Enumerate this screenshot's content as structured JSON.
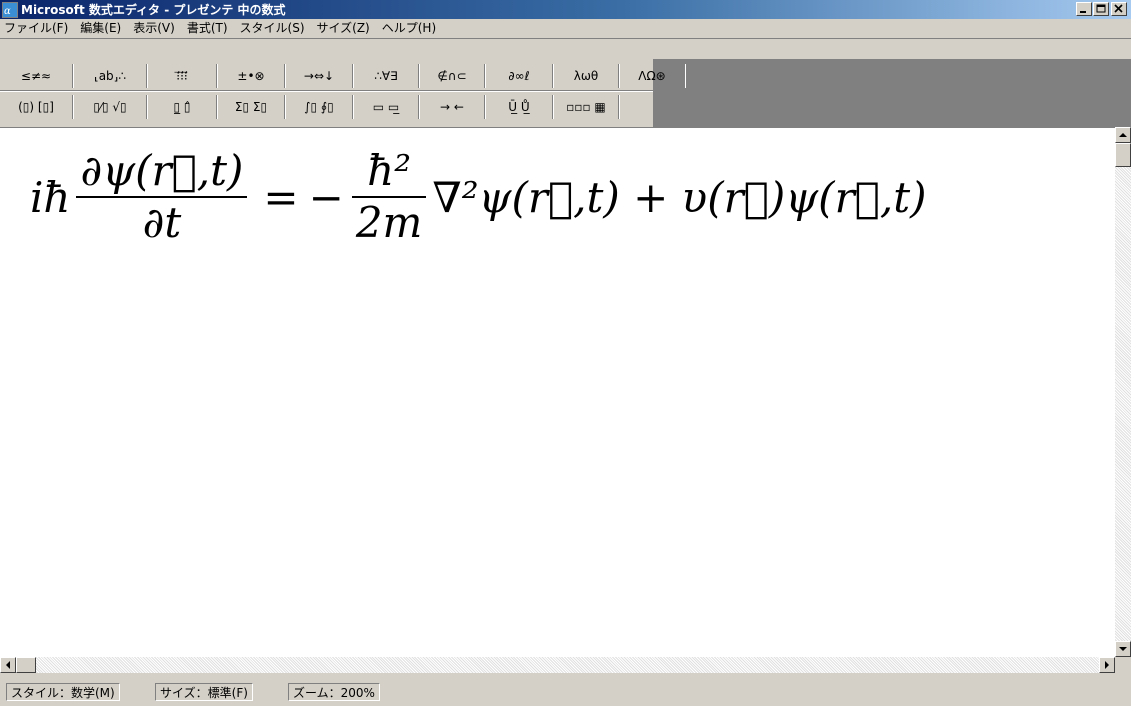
{
  "window": {
    "title": "Microsoft 数式エディタ - プレゼンテ 中の数式"
  },
  "menu": {
    "items": [
      "ファイル(F)",
      "編集(E)",
      "表示(V)",
      "書式(T)",
      "スタイル(S)",
      "サイズ(Z)",
      "ヘルプ(H)"
    ]
  },
  "toolbar": {
    "row1": [
      "≤≠≈",
      "⸤ab⸥∴",
      "⁝⃗⁝⃗⁝⃗",
      "±•⊗",
      "→⇔↓",
      "∴∀∃",
      "∉∩⊂",
      "∂∞ℓ",
      "λωθ",
      "ΛΩ⊛"
    ],
    "row2": [
      "(▯) [▯]",
      "▯⁄▯ √▯",
      "▯̲ ▯̂",
      "Σ▯ Σ▯",
      "∫▯ ∮▯",
      "▭ ▭̲",
      "→ ←",
      "Ū̲ Ů̲",
      "▫▫▫ ▦"
    ]
  },
  "equation": {
    "lhs_prefix": "iħ",
    "lhs_num": "∂ψ(r⃗,t)",
    "lhs_den": "∂t",
    "equals": "=",
    "minus": "−",
    "rhs_num": "ħ²",
    "rhs_den": "2m",
    "rhs_tail": "∇²ψ(r⃗,t) + υ(r⃗)ψ(r⃗,t)"
  },
  "statusbar": {
    "style": "スタイル：数学(M)",
    "size": "サイズ：標準(F)",
    "zoom": "ズーム：200%"
  }
}
